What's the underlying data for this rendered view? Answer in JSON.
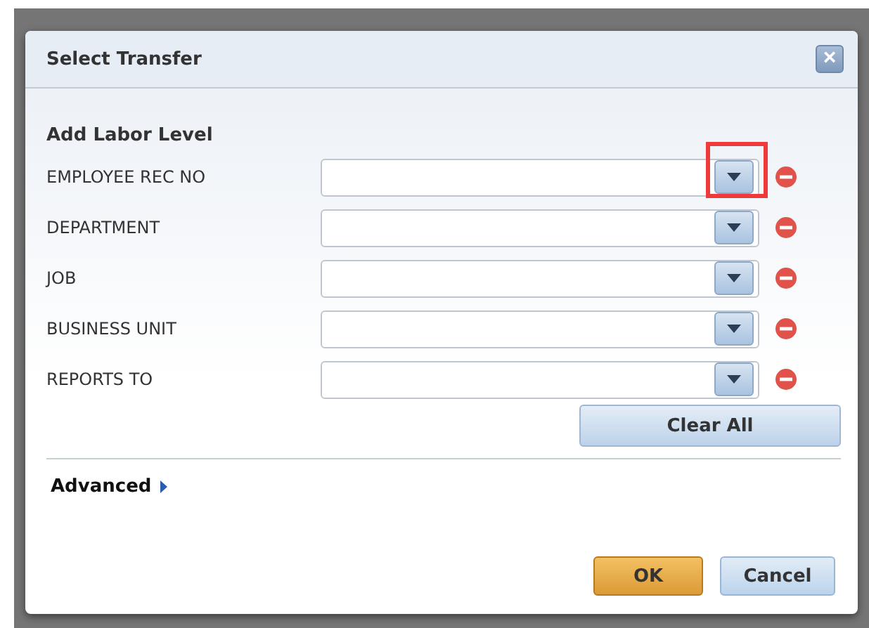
{
  "dialog": {
    "title": "Select Transfer",
    "close_icon": "×"
  },
  "section": {
    "title": "Add Labor Level"
  },
  "rows": [
    {
      "label": "EMPLOYEE REC NO",
      "value": "",
      "highlighted": true
    },
    {
      "label": "DEPARTMENT",
      "value": "",
      "highlighted": false
    },
    {
      "label": "JOB",
      "value": "",
      "highlighted": false
    },
    {
      "label": "BUSINESS UNIT",
      "value": "",
      "highlighted": false
    },
    {
      "label": "REPORTS TO",
      "value": "",
      "highlighted": false
    }
  ],
  "clear_button": "Clear All",
  "advanced": {
    "label": "Advanced",
    "expanded": false
  },
  "buttons": [
    {
      "label": "OK",
      "kind": "primary"
    },
    {
      "label": "Cancel",
      "kind": "secondary"
    }
  ]
}
